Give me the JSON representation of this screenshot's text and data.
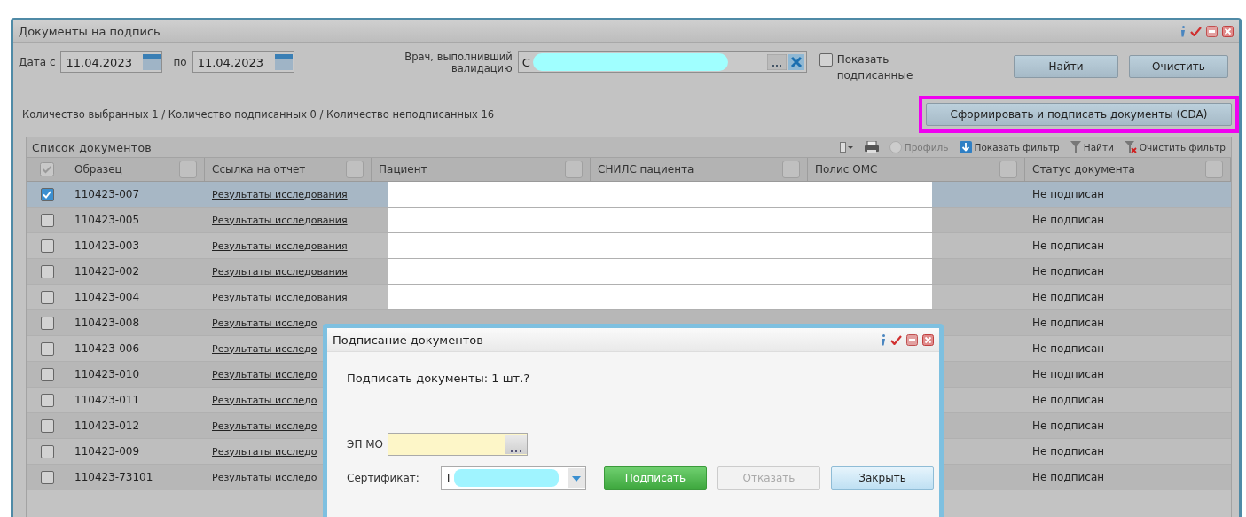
{
  "window": {
    "title": "Документы на подпись"
  },
  "filters": {
    "date_from_label": "Дата с",
    "date_from": "11.04.2023",
    "date_to_label": "по",
    "date_to": "11.04.2023",
    "doctor_label": "Врач, выполнивший валидацию",
    "doctor_value": "С",
    "show_signed": {
      "label": "Показать подписанные",
      "checked": false
    }
  },
  "buttons": [
    {
      "label": "Найти"
    },
    {
      "label": "Очистить"
    }
  ],
  "counts": "Количество выбранных 1 / Количество подписанных 0 / Количество неподписанных 16",
  "sign_button": {
    "label": "Сформировать и подписать документы (CDA)",
    "highlighted": true
  },
  "grid": {
    "title": "Список документов",
    "toolbar": [
      {
        "kind": "columns"
      },
      {
        "kind": "print"
      },
      {
        "kind": "profile",
        "label": "Профиль",
        "disabled": true
      },
      {
        "kind": "show-filter",
        "label": "Показать фильтр",
        "disabled": false
      },
      {
        "kind": "find",
        "label": "Найти",
        "disabled": false
      },
      {
        "kind": "clear-filter",
        "label": "Очистить фильтр",
        "disabled": false
      }
    ],
    "columns": [
      "Образец",
      "Ссылка на отчет",
      "Пациент",
      "СНИЛС пациента",
      "Полис ОМС",
      "Статус документа"
    ],
    "rows": [
      {
        "sample": "110423-007",
        "link": "Результаты исследования",
        "status": "Не подписан",
        "selected": true,
        "redacted": true
      },
      {
        "sample": "110423-005",
        "link": "Результаты исследования",
        "status": "Не подписан",
        "selected": false,
        "redacted": true
      },
      {
        "sample": "110423-003",
        "link": "Результаты исследования",
        "status": "Не подписан",
        "selected": false,
        "redacted": true
      },
      {
        "sample": "110423-002",
        "link": "Результаты исследования",
        "status": "Не подписан",
        "selected": false,
        "redacted": true
      },
      {
        "sample": "110423-004",
        "link": "Результаты исследования",
        "status": "Не подписан",
        "selected": false,
        "redacted": true
      },
      {
        "sample": "110423-008",
        "link": "Результаты исследо",
        "status": "Не подписан",
        "selected": false
      },
      {
        "sample": "110423-006",
        "link": "Результаты исследо",
        "status": "Не подписан",
        "selected": false
      },
      {
        "sample": "110423-010",
        "link": "Результаты исследо",
        "status": "Не подписан",
        "selected": false
      },
      {
        "sample": "110423-011",
        "link": "Результаты исследо",
        "status": "Не подписан",
        "selected": false
      },
      {
        "sample": "110423-012",
        "link": "Результаты исследо",
        "status": "Не подписан",
        "selected": false
      },
      {
        "sample": "110423-009",
        "link": "Результаты исследо",
        "status": "Не подписан",
        "selected": false
      },
      {
        "sample": "110423-73101",
        "link": "Результаты исследо",
        "status": "Не подписан",
        "selected": false
      }
    ]
  },
  "dialog": {
    "title": "Подписание документов",
    "message": "Подписать документы: 1 шт.?",
    "ep_label": "ЭП МО",
    "cert_label": "Сертификат:",
    "cert_value": "Т",
    "buttons": [
      {
        "label": "Подписать",
        "kind": "primary"
      },
      {
        "label": "Отказать",
        "kind": "disabled"
      },
      {
        "label": "Закрыть",
        "kind": "default"
      }
    ]
  }
}
